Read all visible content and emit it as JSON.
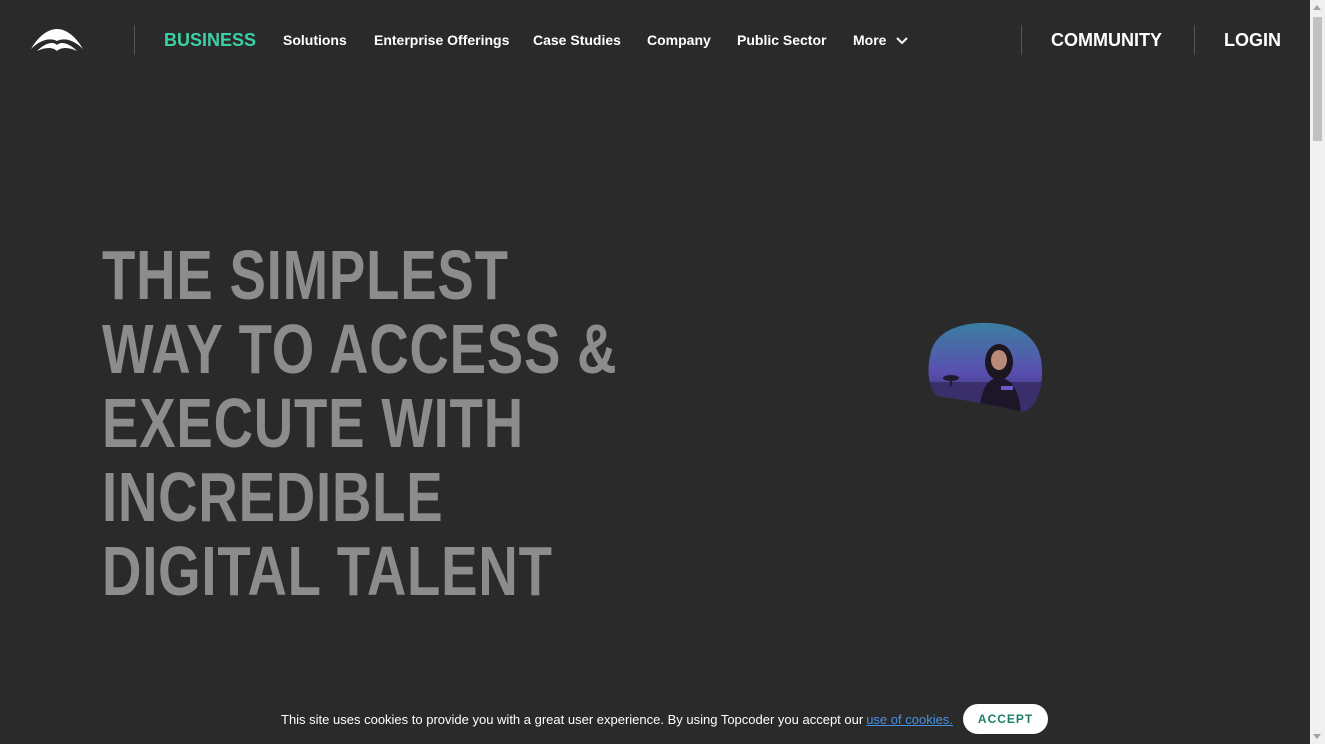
{
  "nav": {
    "logo_icon": "topcoder-logo-icon",
    "business": "BUSINESS",
    "items": [
      "Solutions",
      "Enterprise Offerings",
      "Case Studies",
      "Company",
      "Public Sector",
      "More"
    ],
    "more_icon": "chevron-down-icon",
    "community": "COMMUNITY",
    "login": "LOGIN"
  },
  "hero": {
    "lines": [
      "THE SIMPLEST",
      "WAY TO ACCESS &",
      "EXECUTE WITH",
      "INCREDIBLE",
      "DIGITAL TALENT"
    ]
  },
  "cookie": {
    "text": "This site uses cookies to provide you with a great user experience. By using Topcoder you accept our",
    "link": "use of cookies.",
    "accept": "ACCEPT"
  },
  "colors": {
    "background": "#2a2a2a",
    "accent": "#3bd1a4",
    "hero_text": "#8c8c8c"
  }
}
